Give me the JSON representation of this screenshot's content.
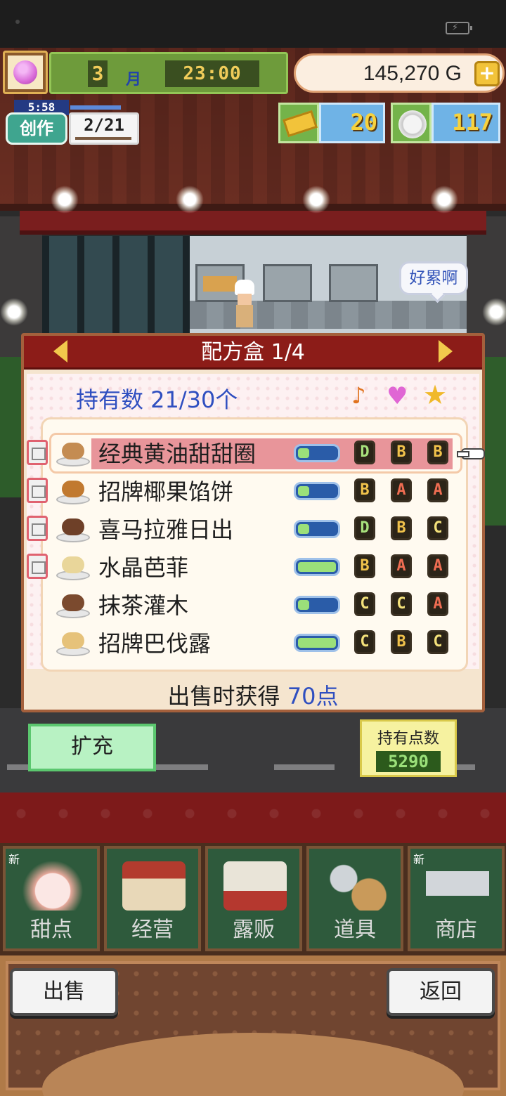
{
  "hud": {
    "month": "3",
    "month_label": "月",
    "time": "23:00",
    "money": "145,270 G",
    "money_plus": "+",
    "create_timer": "5:58",
    "create_label": "创作",
    "create_count": "2/21",
    "tickets": "20",
    "plates": "117"
  },
  "scene": {
    "speech_bubble": "好累啊"
  },
  "dialog": {
    "title": "配方盒 1/4",
    "owned_count": "持有数 21/30个",
    "sort_icons": [
      "music-note-icon",
      "heart-icon",
      "star-icon"
    ],
    "recipes": [
      {
        "name": "经典黄油甜甜圈",
        "level": 0.3,
        "grades": [
          "D",
          "B",
          "B"
        ],
        "selected": true,
        "in_cup": true,
        "food_color": "#c48c52"
      },
      {
        "name": "招牌椰果馅饼",
        "level": 0.3,
        "grades": [
          "B",
          "A",
          "A"
        ],
        "selected": false,
        "in_cup": true,
        "food_color": "#c1792f"
      },
      {
        "name": "喜马拉雅日出",
        "level": 0.3,
        "grades": [
          "D",
          "B",
          "C"
        ],
        "selected": false,
        "in_cup": true,
        "food_color": "#6e4028"
      },
      {
        "name": "水晶芭菲",
        "level": 1.0,
        "grades": [
          "B",
          "A",
          "A"
        ],
        "selected": false,
        "in_cup": true,
        "food_color": "#e9d69a"
      },
      {
        "name": "抹茶灌木",
        "level": 0.3,
        "grades": [
          "C",
          "C",
          "A"
        ],
        "selected": false,
        "in_cup": false,
        "food_color": "#7b4a2e"
      },
      {
        "name": "招牌巴伐露",
        "level": 1.0,
        "grades": [
          "C",
          "B",
          "C"
        ],
        "selected": false,
        "in_cup": false,
        "food_color": "#e6c27a"
      }
    ],
    "sell_points_label": "出售时获得",
    "sell_points_value": "70点"
  },
  "actions": {
    "expand": "扩充",
    "points_label": "持有点数",
    "points_value": "5290",
    "sell": "出售",
    "back": "返回"
  },
  "menu": [
    {
      "label": "甜点",
      "new": "新",
      "icon": "cake-icon"
    },
    {
      "label": "经营",
      "new": "",
      "icon": "shop-icon"
    },
    {
      "label": "露贩",
      "new": "",
      "icon": "food-truck-icon"
    },
    {
      "label": "道具",
      "new": "",
      "icon": "items-bag-icon"
    },
    {
      "label": "商店",
      "new": "新",
      "icon": "shopping-cart-icon"
    }
  ],
  "colors": {
    "header_red": "#8c1c18",
    "highlight_pink": "#e8959a",
    "count_blue": "#2f4fc0",
    "menu_green": "#2e5a3c"
  }
}
